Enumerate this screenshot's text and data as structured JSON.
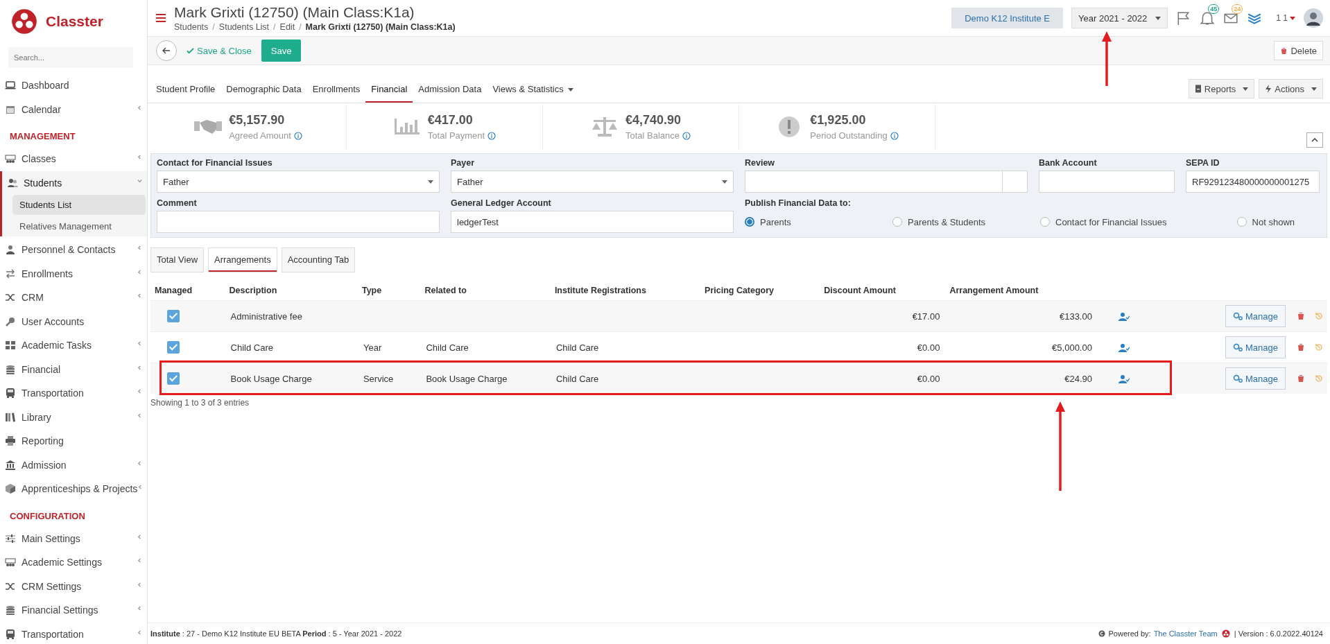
{
  "sidebar": {
    "logo": "Classter",
    "search_placeholder": "Search...",
    "items": [
      {
        "kind": "item",
        "label": "Dashboard",
        "has_submenu": false,
        "expanded": false
      },
      {
        "kind": "item",
        "label": "Calendar",
        "has_submenu": true,
        "expanded": false
      },
      {
        "kind": "section",
        "label": "MANAGEMENT"
      },
      {
        "kind": "item",
        "label": "Classes",
        "has_submenu": true,
        "expanded": false
      },
      {
        "kind": "item",
        "label": "Students",
        "has_submenu": true,
        "expanded": true,
        "children": [
          {
            "label": "Students List",
            "selected": true
          },
          {
            "label": "Relatives Management",
            "selected": false
          }
        ]
      },
      {
        "kind": "item",
        "label": "Personnel & Contacts",
        "has_submenu": true,
        "expanded": false
      },
      {
        "kind": "item",
        "label": "Enrollments",
        "has_submenu": true,
        "expanded": false
      },
      {
        "kind": "item",
        "label": "CRM",
        "has_submenu": true,
        "expanded": false
      },
      {
        "kind": "item",
        "label": "User Accounts",
        "has_submenu": false,
        "expanded": false
      },
      {
        "kind": "item",
        "label": "Academic Tasks",
        "has_submenu": true,
        "expanded": false
      },
      {
        "kind": "item",
        "label": "Financial",
        "has_submenu": true,
        "expanded": false
      },
      {
        "kind": "item",
        "label": "Transportation",
        "has_submenu": true,
        "expanded": false
      },
      {
        "kind": "item",
        "label": "Library",
        "has_submenu": true,
        "expanded": false
      },
      {
        "kind": "item",
        "label": "Reporting",
        "has_submenu": false,
        "expanded": false
      },
      {
        "kind": "item",
        "label": "Admission",
        "has_submenu": true,
        "expanded": false
      },
      {
        "kind": "item",
        "label": "Apprenticeships & Projects",
        "has_submenu": true,
        "expanded": false
      },
      {
        "kind": "section",
        "label": "CONFIGURATION"
      },
      {
        "kind": "item",
        "label": "Main Settings",
        "has_submenu": true,
        "expanded": false
      },
      {
        "kind": "item",
        "label": "Academic Settings",
        "has_submenu": true,
        "expanded": false
      },
      {
        "kind": "item",
        "label": "CRM Settings",
        "has_submenu": true,
        "expanded": false
      },
      {
        "kind": "item",
        "label": "Financial Settings",
        "has_submenu": true,
        "expanded": false
      },
      {
        "kind": "item",
        "label": "Transportation",
        "has_submenu": true,
        "expanded": false
      }
    ]
  },
  "header": {
    "title": "Mark Grixti (12750) (Main Class:K1a)",
    "breadcrumb": [
      "Students",
      "Students List",
      "Edit",
      "Mark Grixti (12750) (Main Class:K1a)"
    ],
    "breadcrumb_separators": [
      "/",
      "/",
      "/"
    ],
    "institute": "Demo K12 Institute E",
    "year": "Year 2021 - 2022",
    "notifications": "45",
    "messages": "24",
    "user": "1 1"
  },
  "toolbar": {
    "save_close": "Save & Close",
    "save": "Save",
    "delete": "Delete"
  },
  "tabs": [
    {
      "label": "Student Profile",
      "selected": false
    },
    {
      "label": "Demographic Data",
      "selected": false
    },
    {
      "label": "Enrollments",
      "selected": false
    },
    {
      "label": "Financial",
      "selected": true
    },
    {
      "label": "Admission Data",
      "selected": false
    },
    {
      "label": "Views & Statistics",
      "selected": false,
      "dropdown": true
    }
  ],
  "tab_actions": [
    "Reports",
    "Actions"
  ],
  "summary": [
    {
      "amount": "€5,157.90",
      "label": "Agreed Amount"
    },
    {
      "amount": "€417.00",
      "label": "Total Payment"
    },
    {
      "amount": "€4,740.90",
      "label": "Total Balance"
    },
    {
      "amount": "€1,925.00",
      "label": "Period Outstanding"
    }
  ],
  "form": {
    "contact_label": "Contact for Financial Issues",
    "contact_value": "Father",
    "payer_label": "Payer",
    "payer_value": "Father",
    "review_label": "Review",
    "bank_label": "Bank Account",
    "sepa_label": "SEPA ID",
    "sepa_value": "RF929123480000000001275",
    "comment_label": "Comment",
    "ledger_label": "General Ledger Account",
    "ledger_value": "ledgerTest",
    "publish_label": "Publish Financial Data to:",
    "publish_options": [
      {
        "label": "Parents",
        "selected": true
      },
      {
        "label": "Parents & Students",
        "selected": false
      },
      {
        "label": "Contact for Financial Issues",
        "selected": false
      },
      {
        "label": "Not shown",
        "selected": false
      }
    ]
  },
  "subtabs": [
    {
      "label": "Total View",
      "selected": false
    },
    {
      "label": "Arrangements",
      "selected": true
    },
    {
      "label": "Accounting Tab",
      "selected": false
    }
  ],
  "table": {
    "columns": [
      "Managed",
      "Description",
      "Type",
      "Related to",
      "Institute Registrations",
      "Pricing Category",
      "Discount Amount",
      "Arrangement Amount"
    ],
    "rows": [
      {
        "managed": true,
        "description": "Administrative fee",
        "discount": "€17.00",
        "amount": "€133.00",
        "action": "Manage",
        "highlighted": false
      },
      {
        "managed": true,
        "description": "Child Care",
        "type": "Year",
        "related": "Child Care",
        "registration": "Child Care",
        "discount": "€0.00",
        "amount": "€5,000.00",
        "action": "Manage",
        "highlighted": false
      },
      {
        "managed": true,
        "description": "Book Usage Charge",
        "type": "Service",
        "related": "Book Usage Charge",
        "registration": "Child Care",
        "discount": "€0.00",
        "amount": "€24.90",
        "action": "Manage",
        "highlighted": true
      }
    ],
    "info": "Showing 1 to 3 of 3 entries"
  },
  "footer": {
    "left": "**Institute** : 27 - Demo K12 Institute EU BETA **Period** : 5 - Year 2021 - 2022",
    "powered": "Powered by:",
    "team": "The Classter Team",
    "version": "| Version : 6.0.2022.40124"
  }
}
